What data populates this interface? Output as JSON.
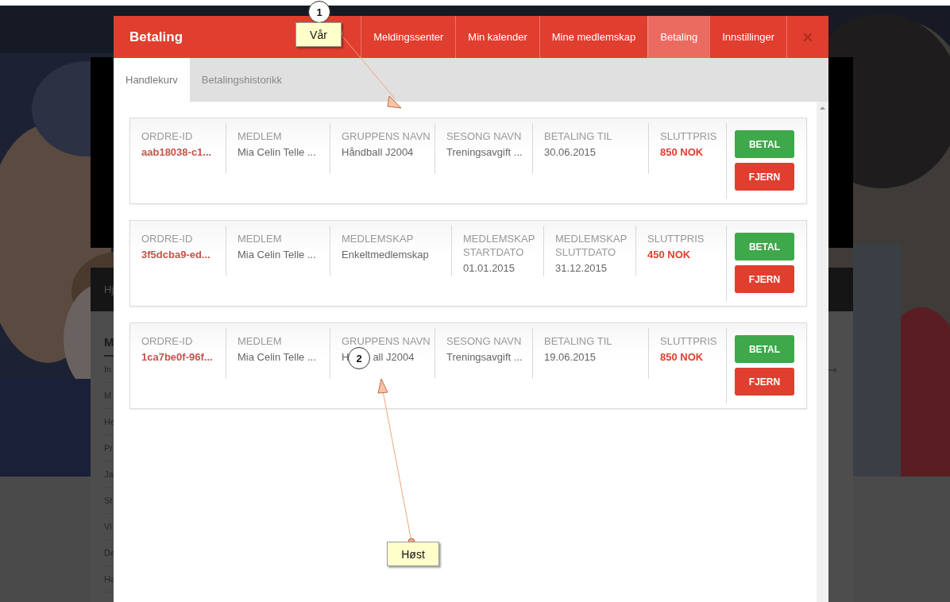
{
  "background_page": {
    "nav": [
      "Hj"
    ],
    "sidebar": {
      "heading": "M",
      "items": [
        "In",
        "M",
        "He",
        "Pr",
        "Ja",
        "St",
        "Vi",
        "De",
        "Ha"
      ]
    }
  },
  "dialog": {
    "title": "Betaling",
    "nav": [
      {
        "label": "Meldingssenter",
        "selected": false
      },
      {
        "label": "Min kalender",
        "selected": false
      },
      {
        "label": "Mine medlemskap",
        "selected": false
      },
      {
        "label": "Betaling",
        "selected": true
      },
      {
        "label": "Innstillinger",
        "selected": false
      }
    ],
    "close": "×",
    "tabs": [
      {
        "label": "Handlekurv",
        "selected": true
      },
      {
        "label": "Betalingshistorikk",
        "selected": false
      }
    ],
    "orders": [
      {
        "kind": "season",
        "columns": [
          {
            "label": "ORDRE-ID",
            "value": "aab18038-c1...",
            "kind": "id"
          },
          {
            "label": "MEDLEM",
            "value": "Mia Celin Telle ...",
            "kind": "text"
          },
          {
            "label": "GRUPPENS NAVN",
            "value": "Håndball J2004",
            "kind": "text"
          },
          {
            "label": "SESONG NAVN",
            "value": "Treningsavgift ...",
            "kind": "text"
          },
          {
            "label": "BETALING TIL",
            "value": "30.06.2015",
            "kind": "text"
          },
          {
            "label": "SLUTTPRIS",
            "value": "850 NOK",
            "kind": "price"
          }
        ],
        "buttons": [
          "BETAL",
          "FJERN"
        ]
      },
      {
        "kind": "membership",
        "columns": [
          {
            "label": "ORDRE-ID",
            "value": "3f5dcba9-ed...",
            "kind": "id"
          },
          {
            "label": "MEDLEM",
            "value": "Mia Celin Telle ...",
            "kind": "text"
          },
          {
            "label": "MEDLEMSKAP",
            "value": "Enkeltmedlemskap",
            "kind": "text"
          },
          {
            "label": "MEDLEMSKAP STARTDATO",
            "value": "01.01.2015",
            "kind": "text"
          },
          {
            "label": "MEDLEMSKAP SLUTTDATO",
            "value": "31.12.2015",
            "kind": "text"
          },
          {
            "label": "SLUTTPRIS",
            "value": "450 NOK",
            "kind": "price"
          }
        ],
        "buttons": [
          "BETAL",
          "FJERN"
        ]
      },
      {
        "kind": "season",
        "columns": [
          {
            "label": "ORDRE-ID",
            "value": "1ca7be0f-96f...",
            "kind": "id"
          },
          {
            "label": "MEDLEM",
            "value": "Mia Celin Telle ...",
            "kind": "text"
          },
          {
            "label": "GRUPPENS NAVN",
            "value": "H",
            "value_after": "all J2004",
            "kind": "text"
          },
          {
            "label": "SESONG NAVN",
            "value": "Treningsavgift ...",
            "kind": "text"
          },
          {
            "label": "BETALING TIL",
            "value": "19.06.2015",
            "kind": "text"
          },
          {
            "label": "SLUTTPRIS",
            "value": "850 NOK",
            "kind": "price"
          }
        ],
        "buttons": [
          "BETAL",
          "FJERN"
        ]
      }
    ]
  },
  "annotations": [
    {
      "number": "1",
      "label": "Vår"
    },
    {
      "number": "2",
      "label": "Høst"
    }
  ]
}
